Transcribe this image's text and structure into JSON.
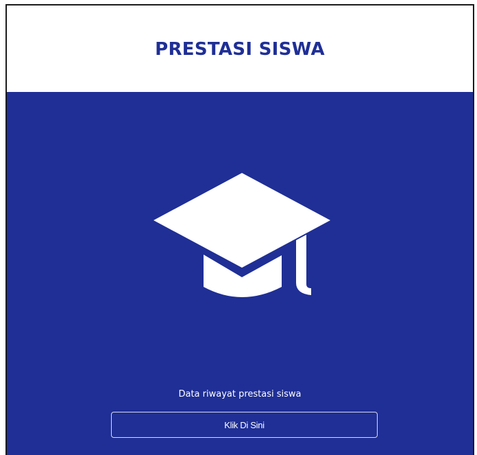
{
  "header": {
    "title": "PRESTASI SISWA"
  },
  "main": {
    "icon": "graduation-cap-icon",
    "description": "Data riwayat prestasi siswa",
    "button_label": "Klik Di Sini"
  },
  "colors": {
    "primary": "#1f2f96",
    "background": "#ffffff",
    "text_on_primary": "#ffffff"
  }
}
